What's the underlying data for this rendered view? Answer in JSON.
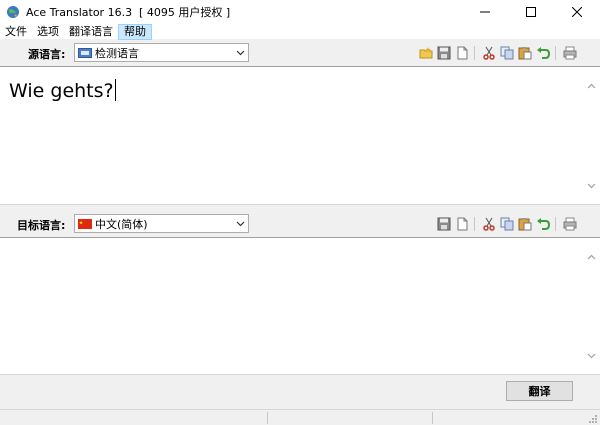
{
  "window": {
    "title": "Ace Translator 16.3  [ 4095 用户授权 ]"
  },
  "menu": {
    "items": [
      {
        "label": "文件"
      },
      {
        "label": "选项"
      },
      {
        "label": "翻译语言"
      },
      {
        "label": "帮助"
      }
    ]
  },
  "source": {
    "label": "源语言:",
    "language": "检测语言",
    "text": "Wie gehts?"
  },
  "target": {
    "label": "目标语言:",
    "language": "中文(简体)",
    "text": ""
  },
  "actions": {
    "translate_label": "翻译"
  },
  "colors": {
    "accent_menu": "#cce8ff",
    "china_flag": "#de2910",
    "detect_icon": "#4a7fc6"
  },
  "icons": {
    "source_toolbar": [
      "magic-folder-icon",
      "save-icon",
      "new-document-icon",
      "cut-icon",
      "copy-icon",
      "paste-icon",
      "undo-icon",
      "print-icon"
    ],
    "target_toolbar": [
      "save-icon",
      "new-document-icon",
      "cut-icon",
      "copy-icon",
      "paste-icon",
      "undo-icon",
      "print-icon"
    ]
  }
}
